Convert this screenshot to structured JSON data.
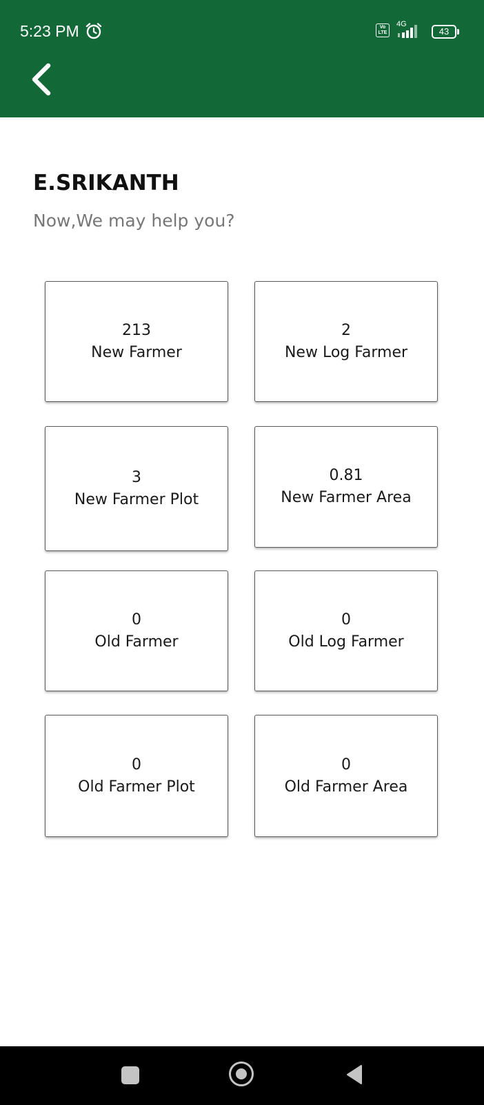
{
  "status_bar": {
    "time": "5:23 PM",
    "volte": "Vo LTE",
    "network": "4G",
    "battery": "43",
    "colors": {
      "background": "#136837",
      "icons": "#ffffff"
    }
  },
  "app_bar": {
    "back_icon": "chevron-left-icon"
  },
  "user": {
    "name": "E.SRIKANTH",
    "subtitle": "Now,We may help you?"
  },
  "cards": [
    {
      "value": "213",
      "label": "New Farmer"
    },
    {
      "value": "2",
      "label": "New Log Farmer"
    },
    {
      "value": "3",
      "label": "New Farmer Plot"
    },
    {
      "value": "0.81",
      "label": "New Farmer Area"
    },
    {
      "value": "0",
      "label": "Old Farmer"
    },
    {
      "value": "0",
      "label": "Old Log Farmer"
    },
    {
      "value": "0",
      "label": "Old Farmer Plot"
    },
    {
      "value": "0",
      "label": "Old Farmer Area"
    }
  ],
  "nav_bar": {
    "recents_icon": "square-icon",
    "home_icon": "circle-icon",
    "back_icon": "triangle-back-icon"
  }
}
